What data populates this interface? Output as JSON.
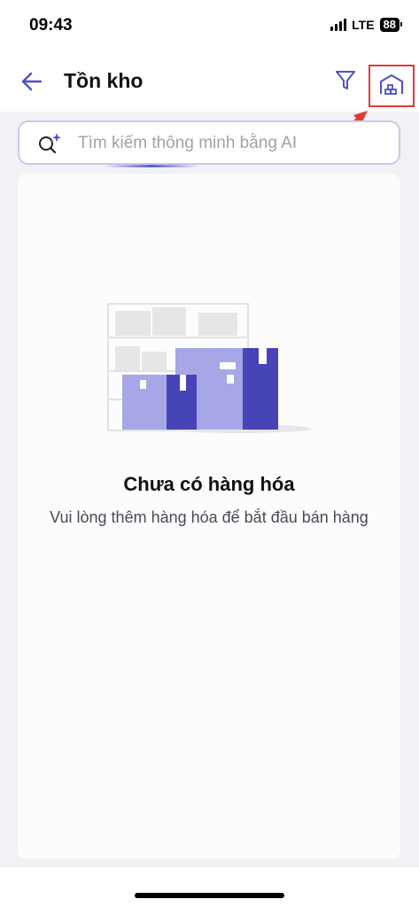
{
  "status_bar": {
    "time": "09:43",
    "network": "LTE",
    "battery": "88"
  },
  "header": {
    "title": "Tồn kho"
  },
  "search": {
    "placeholder": "Tìm kiếm thông minh bằng AI"
  },
  "empty_state": {
    "title": "Chưa có hàng hóa",
    "subtitle": "Vui lòng thêm hàng hóa để bắt đầu bán hàng"
  },
  "icons": {
    "back": "arrow-left-icon",
    "filter": "funnel-icon",
    "warehouse": "warehouse-icon",
    "search": "ai-search-icon"
  },
  "colors": {
    "accent": "#4f4fc8",
    "highlight": "#e03a3a",
    "box_light": "#a7a6e6",
    "box_dark": "#4744b8"
  }
}
